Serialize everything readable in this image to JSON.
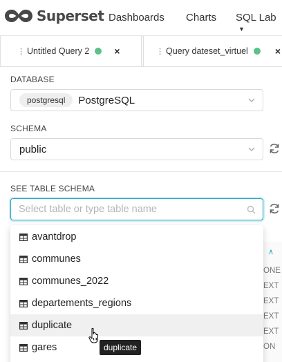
{
  "app": {
    "brand": "Superset"
  },
  "nav": {
    "items": [
      "Dashboards",
      "Charts",
      "SQL Lab"
    ]
  },
  "tabs": [
    {
      "label": "Untitled Query 2",
      "status_color": "#5ac189",
      "close": "×"
    },
    {
      "label": "Query dateset_virtuel",
      "status_color": "#5ac189",
      "close": "×"
    }
  ],
  "database": {
    "label": "DATABASE",
    "tag": "postgresql",
    "value": "PostgreSQL"
  },
  "schema": {
    "label": "SCHEMA",
    "value": "public"
  },
  "table_schema": {
    "label": "SEE TABLE SCHEMA",
    "placeholder": "Select table or type table name"
  },
  "dropdown": {
    "options": [
      "avantdrop",
      "communes",
      "communes_2022",
      "departements_regions",
      "duplicate",
      "gares"
    ],
    "hovered_index": 4
  },
  "background_types": [
    "ONE",
    "EXT",
    "EXT",
    "EXT",
    "EXT",
    "ON"
  ],
  "tooltip": {
    "text": "duplicate"
  },
  "colors": {
    "accent": "#20a7c9",
    "status": "#5ac189"
  }
}
